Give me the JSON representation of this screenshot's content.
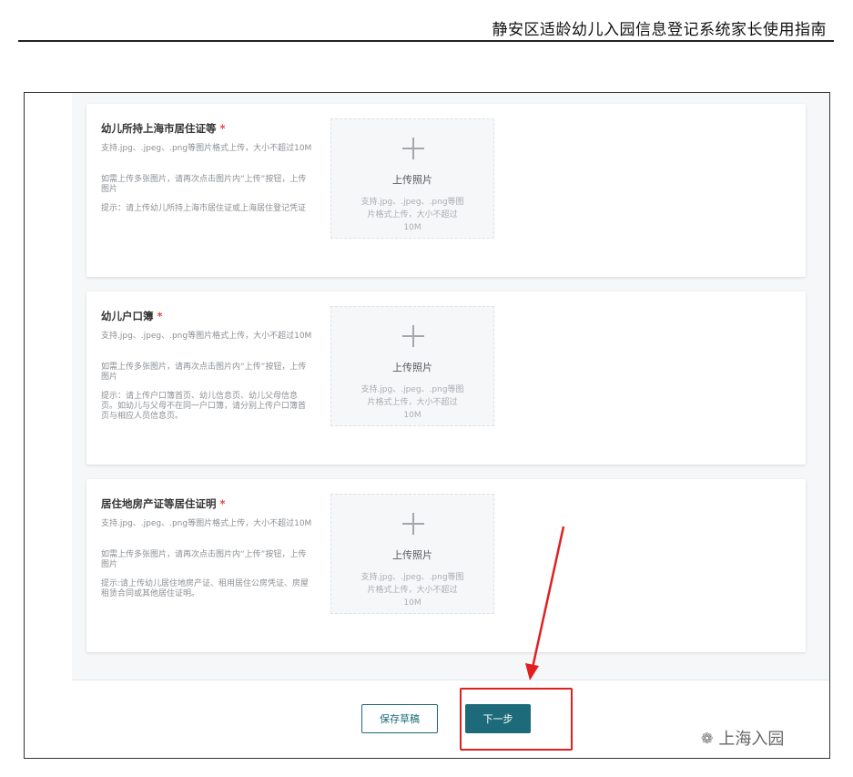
{
  "document": {
    "header_title": "静安区适龄幼儿入园信息登记系统家长使用指南"
  },
  "upload_cards": [
    {
      "title": "幼儿所持上海市居住证等",
      "required_mark": "*",
      "desc1": "支持.jpg、.jpeg、.png等图片格式上传，大小不超过10M",
      "desc2": "如需上传多张图片，请再次点击图片内“上传”按钮，上传图片",
      "desc3": "提示：请上传幼儿所持上海市居住证或上海居住登记凭证",
      "upload_label": "上传照片",
      "upload_hint": "支持.jpg、.jpeg、.png等图片格式上传，大小不超过10M"
    },
    {
      "title": "幼儿户口簿",
      "required_mark": "*",
      "desc1": "支持.jpg、.jpeg、.png等图片格式上传，大小不超过10M",
      "desc2": "如需上传多张图片，请再次点击图片内“上传”按钮，上传图片",
      "desc3": "提示：请上传户口簿首页、幼儿信息页、幼儿父母信息页。如幼儿与父母不在同一户口簿，请分别上传户口簿首页与相应人员信息页。",
      "upload_label": "上传照片",
      "upload_hint": "支持.jpg、.jpeg、.png等图片格式上传，大小不超过10M"
    },
    {
      "title": "居住地房产证等居住证明",
      "required_mark": "*",
      "desc1": "支持.jpg、.jpeg、.png等图片格式上传，大小不超过10M",
      "desc2": "如需上传多张图片，请再次点击图片内“上传”按钮，上传图片",
      "desc3": "提示:请上传幼儿居住地房产证、租用居住公房凭证、房屋租赁合同或其他居住证明。",
      "upload_label": "上传照片",
      "upload_hint": "支持.jpg、.jpeg、.png等图片格式上传，大小不超过10M"
    }
  ],
  "footer": {
    "save_draft_label": "保存草稿",
    "next_label": "下一步"
  },
  "watermark": {
    "text": "上海入园"
  },
  "colors": {
    "primary": "#1d6b7a",
    "required": "#e04848",
    "annotation": "#e02020"
  }
}
